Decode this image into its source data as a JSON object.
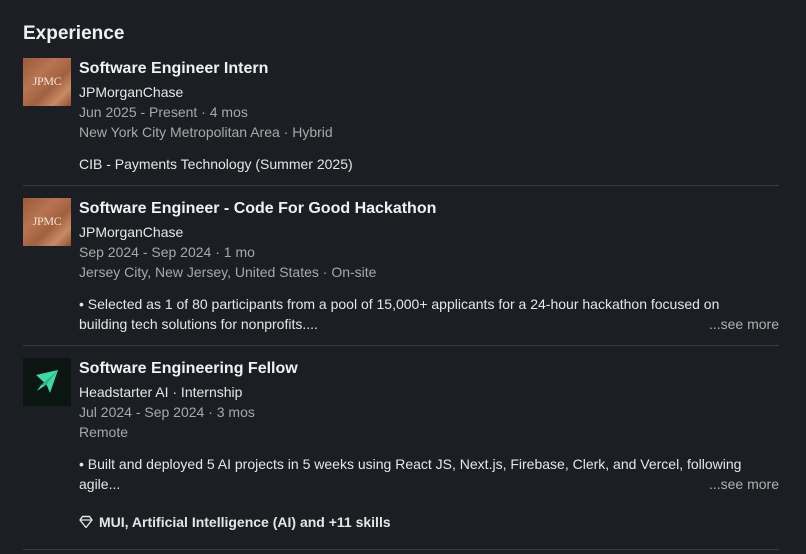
{
  "section": {
    "title": "Experience"
  },
  "entries": [
    {
      "logo_text": "JPMC",
      "logo_icon": "jpmc-logo-icon",
      "title": "Software Engineer Intern",
      "company": "JPMorganChase",
      "dates": "Jun 2025 - Present · 4 mos",
      "location": "New York City Metropolitan Area · Hybrid",
      "description": "CIB - Payments Technology (Summer 2025)"
    },
    {
      "logo_text": "JPMC",
      "logo_icon": "jpmc-logo-icon",
      "title": "Software Engineer - Code For Good Hackathon",
      "company": "JPMorganChase",
      "dates": "Sep 2024 - Sep 2024 · 1 mo",
      "location": "Jersey City, New Jersey, United States · On-site",
      "description_line1": "• Selected as 1 of 80 participants from a pool of 15,000+ applicants for a 24-hour hackathon focused on",
      "description_line2": "building tech solutions for nonprofits....",
      "see_more": "...see more"
    },
    {
      "logo_icon": "headstarter-logo-icon",
      "title": "Software Engineering Fellow",
      "company": "Headstarter AI · Internship",
      "dates": "Jul 2024 - Sep 2024 · 3 mos",
      "location": "Remote",
      "description_line1": "• Built and deployed 5 AI projects in 5 weeks using React JS, Next.js, Firebase, Clerk, and Vercel, following",
      "description_line2": "agile...",
      "see_more": "...see more",
      "skills": "MUI, Artificial Intelligence (AI) and +11 skills"
    }
  ],
  "colors": {
    "background": "#1b1f23",
    "text_primary": "#e9e9e9",
    "text_secondary": "#a8a8a8",
    "divider": "#3a3d40",
    "headstarter_accent": "#3fd9a8"
  }
}
